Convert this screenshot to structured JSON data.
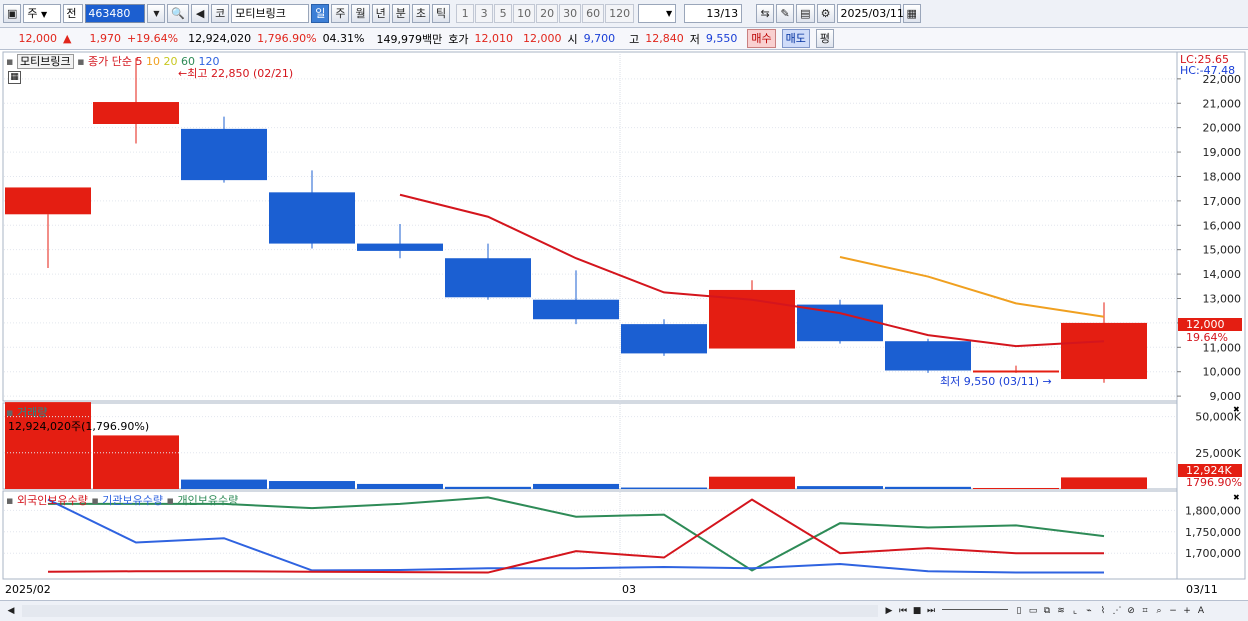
{
  "toolbar": {
    "period_select": "주",
    "prev_label": "전",
    "code": "463480",
    "market_label": "코",
    "stock_name": "모티브링크",
    "period_tabs": [
      "일",
      "주",
      "월",
      "년",
      "분",
      "초",
      "틱"
    ],
    "active_tab": "일",
    "intervals": [
      "1",
      "3",
      "5",
      "10",
      "20",
      "30",
      "60",
      "120"
    ],
    "count": "13/13",
    "date": "2025/03/11"
  },
  "info": {
    "price": "12,000",
    "change": "1,970",
    "change_rate": "+19.64%",
    "volume": "12,924,020",
    "volume_rate": "1,796.90%",
    "turnover": "04.31%",
    "amount": "149,979백만",
    "quote_label": "호가",
    "ask": "12,010",
    "bid": "12,000",
    "open_label": "시",
    "open": "9,700",
    "high_label": "고",
    "high": "12,840",
    "low_label": "저",
    "low": "9,550",
    "buy_button": "매수",
    "sell_button": "매도",
    "eval_button": "평"
  },
  "price_panel": {
    "legend_name": "모티브링크",
    "legend_ma": "종가 단순",
    "ma_periods": [
      "5",
      "10",
      "20",
      "60",
      "120"
    ],
    "high_annot": "최고 22,850 (02/21)",
    "low_annot": "최저 9,550 (03/11)",
    "lc_label": "LC:25.65",
    "hc_label": "HC:-47.48",
    "current_price_tag": "12,000",
    "current_rate_tag": "19.64%",
    "y_ticks": [
      "22,000",
      "21,000",
      "20,000",
      "19,000",
      "18,000",
      "17,000",
      "16,000",
      "15,000",
      "14,000",
      "13,000",
      "12,000",
      "11,000",
      "10,000",
      "9,000"
    ]
  },
  "volume_panel": {
    "title": "거래량",
    "current": "12,924,020주(1,796.90%)",
    "y_ticks": [
      "50,000K",
      "25,000K"
    ],
    "tag_value": "12,924K",
    "tag_rate": "1796.90%"
  },
  "holdings_panel": {
    "legend": [
      "외국인보유수량",
      "기관보유수량",
      "개인보유수량"
    ],
    "y_ticks": [
      "1,800,000",
      "1,750,000",
      "1,700,000"
    ]
  },
  "x_axis": {
    "left": "2025/02",
    "mid": "03",
    "right": "03/11"
  },
  "colors": {
    "up": "#e41e12",
    "down": "#1b5fd2",
    "ma5": "#d4151d",
    "ma10": "#f0a020",
    "foreign": "#d4151d",
    "institution": "#2f63e0",
    "individual": "#2e8b57"
  },
  "chart_data": {
    "type": "candlestick",
    "candles": [
      {
        "open": 16450,
        "high": 16450,
        "low": 14250,
        "close": 17550
      },
      {
        "open": 20150,
        "high": 22850,
        "low": 19350,
        "close": 21050
      },
      {
        "open": 19950,
        "high": 20450,
        "low": 17750,
        "close": 17850
      },
      {
        "open": 17350,
        "high": 18250,
        "low": 15050,
        "close": 15250
      },
      {
        "open": 15250,
        "high": 16050,
        "low": 14650,
        "close": 14950
      },
      {
        "open": 14650,
        "high": 15250,
        "low": 12950,
        "close": 13050
      },
      {
        "open": 12950,
        "high": 14150,
        "low": 11950,
        "close": 12150
      },
      {
        "open": 11950,
        "high": 12150,
        "low": 10650,
        "close": 10750
      },
      {
        "open": 10950,
        "high": 13750,
        "low": 10950,
        "close": 13350
      },
      {
        "open": 12750,
        "high": 12950,
        "low": 11150,
        "close": 11250
      },
      {
        "open": 11250,
        "high": 11350,
        "low": 9950,
        "close": 10050
      },
      {
        "open": 10050,
        "high": 10250,
        "low": 9950,
        "close": 10050
      },
      {
        "open": 9700,
        "high": 12840,
        "low": 9550,
        "close": 12000
      }
    ],
    "ma5": [
      null,
      null,
      null,
      null,
      17250,
      16350,
      14650,
      13250,
      12950,
      12400,
      11500,
      11050,
      11250
    ],
    "ma10": [
      null,
      null,
      null,
      null,
      null,
      null,
      null,
      null,
      null,
      14700,
      13900,
      12800,
      12250
    ],
    "volume": [
      60000,
      37000,
      6500,
      5500,
      3500,
      1500,
      3500,
      1000,
      8500,
      2000,
      1500,
      700,
      8000
    ],
    "foreign": [
      1657000,
      1658000,
      1658000,
      1657000,
      1656000,
      1655000,
      1705000,
      1690000,
      1825000,
      1700000,
      1712000,
      1700000,
      1700000
    ],
    "institution": [
      1825000,
      1725000,
      1735000,
      1660000,
      1661000,
      1665000,
      1665000,
      1668000,
      1665000,
      1675000,
      1658000,
      1655000,
      1655000
    ],
    "individual": [
      1815000,
      1815000,
      1815000,
      1805000,
      1815000,
      1830000,
      1785000,
      1790000,
      1660000,
      1770000,
      1760000,
      1765000,
      1740000
    ],
    "price_ylim": [
      8800,
      23100
    ],
    "volume_ylim": [
      0,
      58000
    ],
    "holdings_ylim": [
      1640000,
      1845000
    ]
  }
}
